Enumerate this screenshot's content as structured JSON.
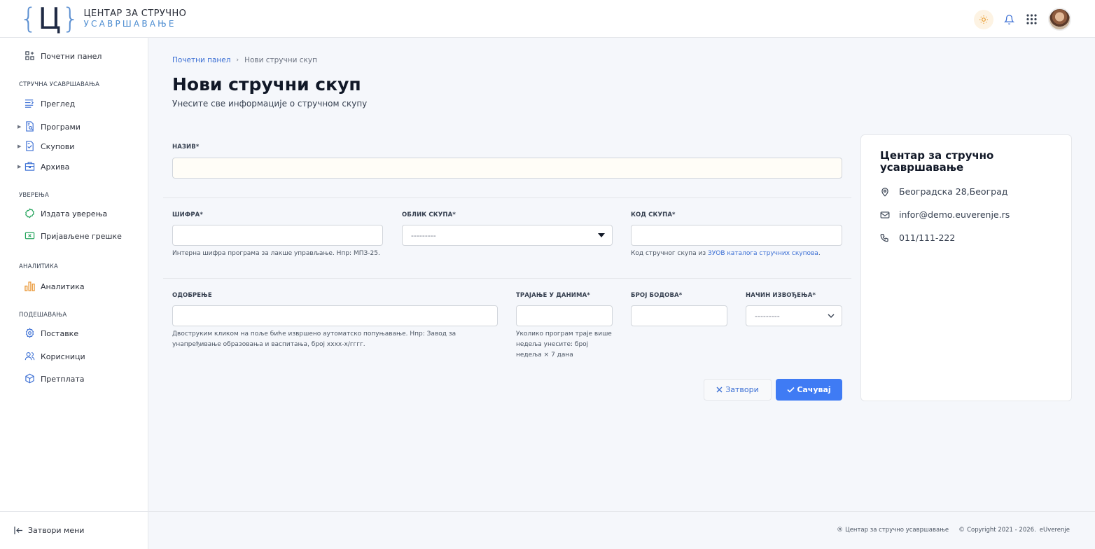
{
  "header": {
    "logo_mark": "Ц",
    "logo_line1": "ЦЕНТАР ЗА СТРУЧНО",
    "logo_line2": "УСАВРШАВАЊЕ",
    "icons": [
      "sun-icon",
      "bell-icon",
      "apps-grid-icon",
      "user-avatar"
    ]
  },
  "sidebar": {
    "dashboard": "Почетни панел",
    "sections": {
      "training": "СТРУЧНА УСАВРШАВАЊА",
      "certificates": "УВЕРЕЊА",
      "analytics": "АНАЛИТИКА",
      "settings": "ПОДЕШАВАЊА"
    },
    "items": {
      "overview": "Преглед",
      "programs": "Програми",
      "gatherings": "Скупови",
      "archive": "Архива",
      "issued": "Издата уверења",
      "reported_errors": "Пријављене грешке",
      "analytics": "Аналитика",
      "preferences": "Поставке",
      "users": "Корисници",
      "subscription": "Претплата"
    },
    "close_menu": "Затвори мени"
  },
  "breadcrumb": {
    "home": "Почетни панел",
    "current": "Нови стручни скуп"
  },
  "page": {
    "title": "Нови стручни скуп",
    "subtitle": "Унесите све информације о стручном скупу"
  },
  "form": {
    "name_label": "НАЗИВ*",
    "name_value": "",
    "code_label": "ШИФРА*",
    "code_hint": "Интерна шифра програма за лакше управљање. Нпр: МПЗ-25.",
    "form_label": "ОБЛИК СКУПА*",
    "form_value": "---------",
    "gathering_code_label": "КОД СКУПА*",
    "gathering_code_hint_prefix": "Код стручног скупа из ",
    "gathering_code_hint_link": "ЗУОВ каталога стручних скупова",
    "gathering_code_hint_suffix": ".",
    "approval_label": "ОДОБРЕЊЕ",
    "approval_hint": "Двоструким кликом на поље биће извршено аутоматско попуњавање. Нпр: Завод за унапређивање образовања и васпитања, број xxxx-x/гггг.",
    "duration_label": "ТРАЈАЊЕ У ДАНИМА*",
    "duration_hint": "Уколико програм траје више недеља унесите: број недеља × 7 дана",
    "points_label": "БРОЈ БОДОВА*",
    "delivery_label": "НАЧИН ИЗВОЂЕЊА*",
    "delivery_value": "---------",
    "close_button": "Затвори",
    "save_button": "Сачувај"
  },
  "card": {
    "title": "Центар за стручно усавршавање",
    "address": "Београдска 28,Београд",
    "email": "infor@demo.euverenje.rs",
    "phone": "011/111-222"
  },
  "footer": {
    "org": "Центар за стручно усавршавање",
    "copyright": "Copyright 2021 - 2026.",
    "brand": "eUverenje"
  }
}
